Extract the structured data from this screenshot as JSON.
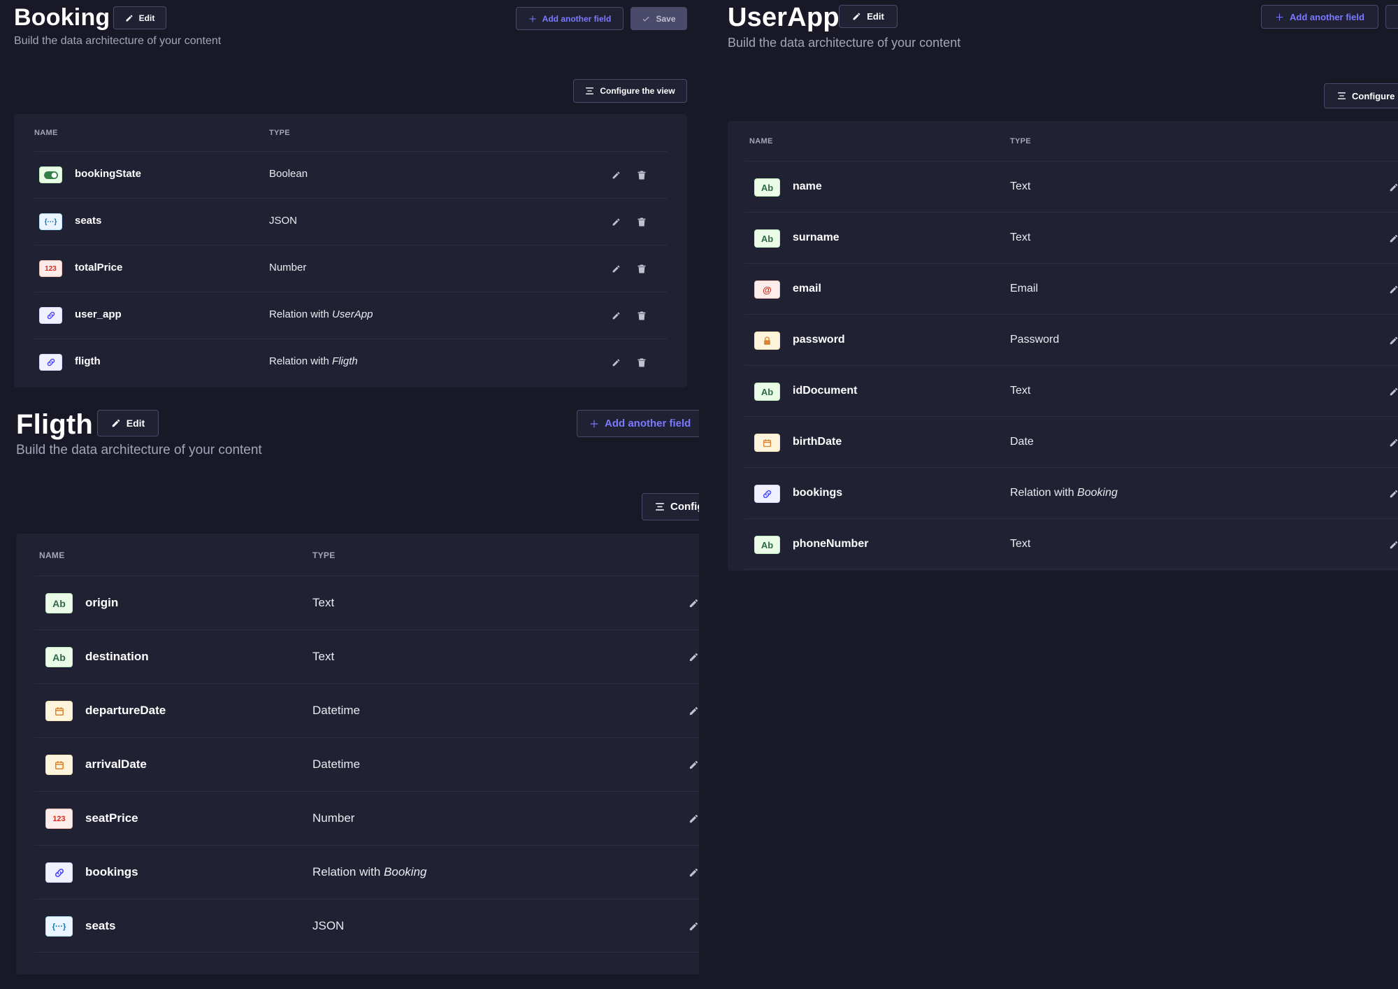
{
  "booking": {
    "title": "Booking",
    "subtitle": "Build the data architecture of your content",
    "edit_label": "Edit",
    "add_field_label": "Add another field",
    "save_label": "Save",
    "configure_label": "Configure the view",
    "col_name": "NAME",
    "col_type": "TYPE",
    "fields": [
      {
        "name": "bookingState",
        "type": "Boolean",
        "icon": "toggle-icon"
      },
      {
        "name": "seats",
        "type": "JSON",
        "icon": "json-icon"
      },
      {
        "name": "totalPrice",
        "type": "Number",
        "icon": "number-icon"
      },
      {
        "name": "user_app",
        "type_prefix": "Relation with ",
        "type_target": "UserApp",
        "icon": "relation-icon"
      },
      {
        "name": "fligth",
        "type_prefix": "Relation with ",
        "type_target": "Fligth",
        "icon": "relation-icon"
      }
    ]
  },
  "userapp": {
    "title": "UserApp",
    "subtitle": "Build the data architecture of your content",
    "edit_label": "Edit",
    "add_field_label": "Add another field",
    "configure_label": "Configure",
    "col_name": "NAME",
    "col_type": "TYPE",
    "fields": [
      {
        "name": "name",
        "type": "Text",
        "icon": "text-icon"
      },
      {
        "name": "surname",
        "type": "Text",
        "icon": "text-icon"
      },
      {
        "name": "email",
        "type": "Email",
        "icon": "email-icon"
      },
      {
        "name": "password",
        "type": "Password",
        "icon": "lock-icon"
      },
      {
        "name": "idDocument",
        "type": "Text",
        "icon": "text-icon"
      },
      {
        "name": "birthDate",
        "type": "Date",
        "icon": "calendar-icon"
      },
      {
        "name": "bookings",
        "type_prefix": "Relation with ",
        "type_target": "Booking",
        "icon": "relation-icon"
      },
      {
        "name": "phoneNumber",
        "type": "Text",
        "icon": "text-icon"
      }
    ]
  },
  "fligth": {
    "title": "Fligth",
    "subtitle": "Build the data architecture of your content",
    "edit_label": "Edit",
    "add_field_label": "Add another field",
    "configure_label": "Config",
    "col_name": "NAME",
    "col_type": "TYPE",
    "fields": [
      {
        "name": "origin",
        "type": "Text",
        "icon": "text-icon"
      },
      {
        "name": "destination",
        "type": "Text",
        "icon": "text-icon"
      },
      {
        "name": "departureDate",
        "type": "Datetime",
        "icon": "calendar-icon"
      },
      {
        "name": "arrivalDate",
        "type": "Datetime",
        "icon": "calendar-icon"
      },
      {
        "name": "seatPrice",
        "type": "Number",
        "icon": "number-icon"
      },
      {
        "name": "bookings",
        "type_prefix": "Relation with ",
        "type_target": "Booking",
        "icon": "relation-icon"
      },
      {
        "name": "seats",
        "type": "JSON",
        "icon": "json-icon"
      }
    ]
  },
  "badges": {
    "text": "Ab",
    "number": "123",
    "email": "@",
    "json": "{···}"
  },
  "colors": {
    "background": "#181826",
    "card": "#212134",
    "primary": "#7b79ff",
    "border": "#4a4a6a",
    "muted": "#a5a5ba"
  }
}
